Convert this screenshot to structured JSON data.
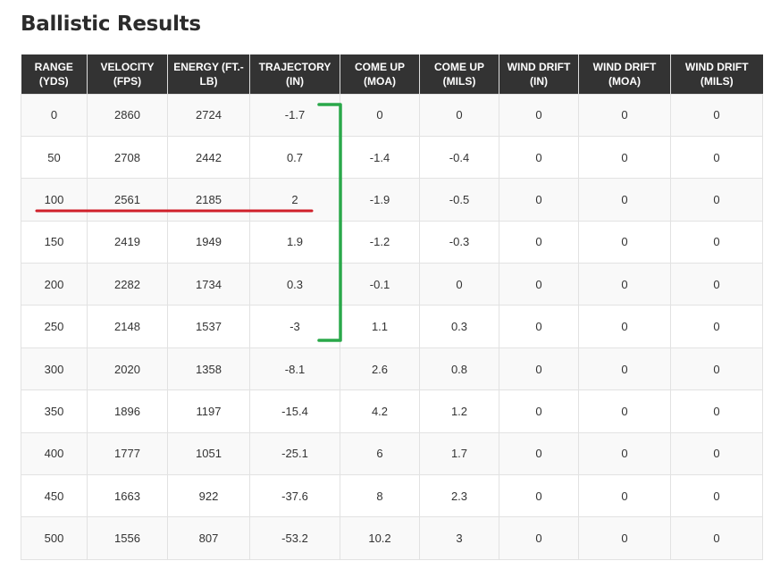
{
  "page": {
    "title": "Ballistic Results"
  },
  "table": {
    "columns": [
      {
        "line1": "RANGE",
        "line2": "(YDS)"
      },
      {
        "line1": "VELOCITY",
        "line2": "(FPS)"
      },
      {
        "line1": "ENERGY (FT.-",
        "line2": "LB)"
      },
      {
        "line1": "TRAJECTORY",
        "line2": "(IN)"
      },
      {
        "line1": "COME UP",
        "line2": "(MOA)"
      },
      {
        "line1": "COME UP",
        "line2": "(MILS)"
      },
      {
        "line1": "WIND DRIFT",
        "line2": "(IN)"
      },
      {
        "line1": "WIND DRIFT",
        "line2": "(MOA)"
      },
      {
        "line1": "WIND DRIFT",
        "line2": "(MILS)"
      }
    ],
    "rows": [
      [
        "0",
        "2860",
        "2724",
        "-1.7",
        "0",
        "0",
        "0",
        "0",
        "0"
      ],
      [
        "50",
        "2708",
        "2442",
        "0.7",
        "-1.4",
        "-0.4",
        "0",
        "0",
        "0"
      ],
      [
        "100",
        "2561",
        "2185",
        "2",
        "-1.9",
        "-0.5",
        "0",
        "0",
        "0"
      ],
      [
        "150",
        "2419",
        "1949",
        "1.9",
        "-1.2",
        "-0.3",
        "0",
        "0",
        "0"
      ],
      [
        "200",
        "2282",
        "1734",
        "0.3",
        "-0.1",
        "0",
        "0",
        "0",
        "0"
      ],
      [
        "250",
        "2148",
        "1537",
        "-3",
        "1.1",
        "0.3",
        "0",
        "0",
        "0"
      ],
      [
        "300",
        "2020",
        "1358",
        "-8.1",
        "2.6",
        "0.8",
        "0",
        "0",
        "0"
      ],
      [
        "350",
        "1896",
        "1197",
        "-15.4",
        "4.2",
        "1.2",
        "0",
        "0",
        "0"
      ],
      [
        "400",
        "1777",
        "1051",
        "-25.1",
        "6",
        "1.7",
        "0",
        "0",
        "0"
      ],
      [
        "450",
        "1663",
        "922",
        "-37.6",
        "8",
        "2.3",
        "0",
        "0",
        "0"
      ],
      [
        "500",
        "1556",
        "807",
        "-53.2",
        "10.2",
        "3",
        "0",
        "0",
        "0"
      ]
    ]
  },
  "annotations": {
    "underline_color": "#d0202a",
    "bracket_color": "#2aa84a"
  }
}
